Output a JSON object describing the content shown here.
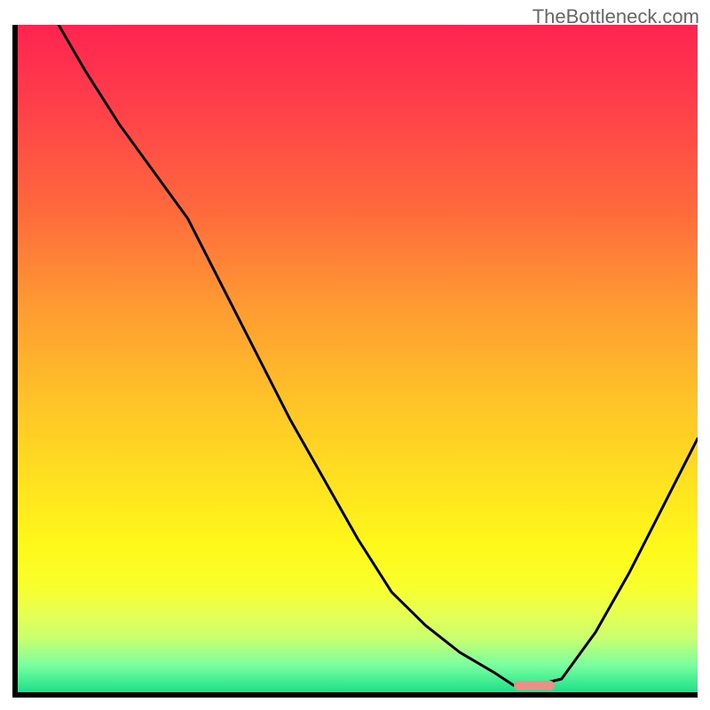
{
  "attribution": "TheBottleneck.com",
  "chart_data": {
    "type": "line",
    "title": "",
    "xlabel": "",
    "ylabel": "",
    "xlim": [
      0,
      100
    ],
    "ylim": [
      0,
      100
    ],
    "grid": false,
    "series": [
      {
        "name": "bottleneck-curve",
        "x": [
          6,
          10,
          15,
          20,
          25,
          30,
          35,
          40,
          45,
          50,
          55,
          60,
          65,
          70,
          73,
          76,
          80,
          85,
          90,
          95,
          100
        ],
        "values": [
          100,
          93,
          85,
          78,
          71,
          61,
          51,
          41,
          32,
          23,
          15,
          10,
          6,
          3,
          1,
          1,
          2,
          9,
          18,
          28,
          38
        ]
      }
    ],
    "marker": {
      "name": "min-point",
      "x_range": [
        73,
        79
      ],
      "y": 1,
      "color": "#e99187"
    },
    "background": "red-yellow-green vertical gradient",
    "axes": {
      "left": true,
      "bottom": true,
      "right": false,
      "top": false,
      "ticks": false
    }
  }
}
